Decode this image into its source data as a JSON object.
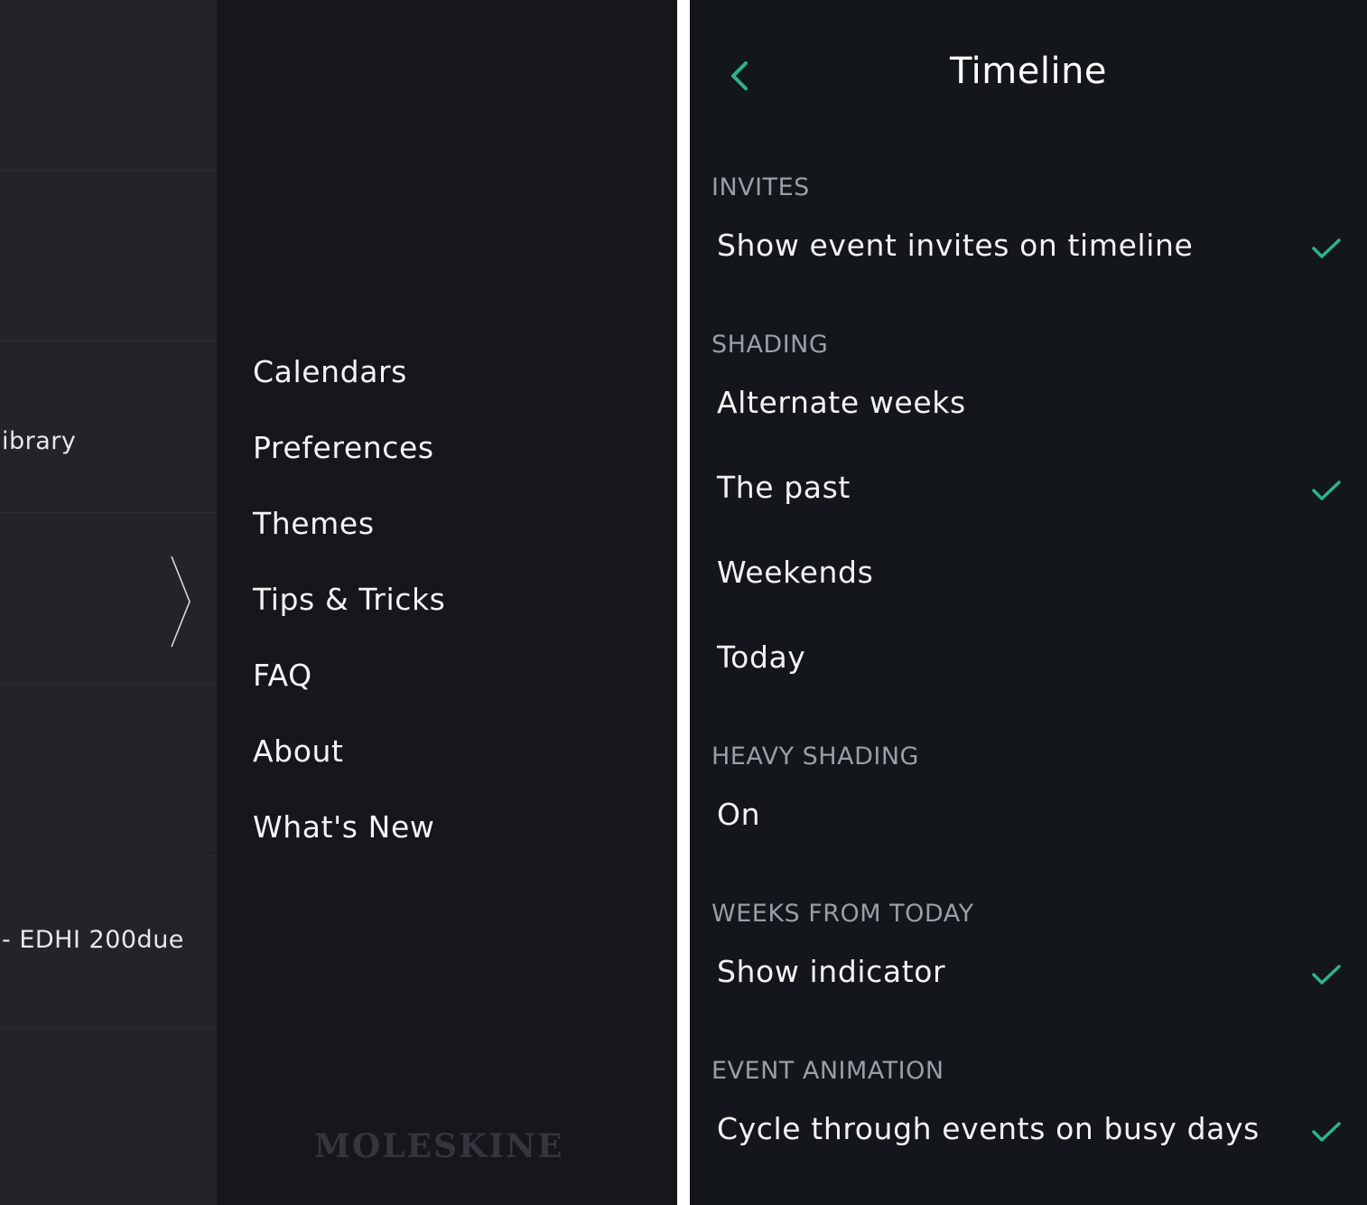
{
  "strip": {
    "row_texts": [
      "ibrary",
      "- EDHI 200due"
    ]
  },
  "menu": {
    "items": [
      "Calendars",
      "Preferences",
      "Themes",
      "Tips & Tricks",
      "FAQ",
      "About",
      "What's New"
    ],
    "logo": "MOLESKINE"
  },
  "panel": {
    "title": "Timeline",
    "sections": [
      {
        "header": "INVITES",
        "rows": [
          {
            "label": "Show event invites on timeline",
            "checked": true
          }
        ]
      },
      {
        "header": "SHADING",
        "rows": [
          {
            "label": "Alternate weeks",
            "checked": false
          },
          {
            "label": "The past",
            "checked": true
          },
          {
            "label": "Weekends",
            "checked": false
          },
          {
            "label": "Today",
            "checked": false
          }
        ]
      },
      {
        "header": "HEAVY SHADING",
        "rows": [
          {
            "label": "On",
            "checked": false
          }
        ]
      },
      {
        "header": "WEEKS FROM TODAY",
        "rows": [
          {
            "label": "Show indicator",
            "checked": true
          }
        ]
      },
      {
        "header": "EVENT ANIMATION",
        "rows": [
          {
            "label": "Cycle through events on busy days",
            "checked": true
          }
        ]
      }
    ]
  },
  "colors": {
    "accent": "#2bb38f",
    "panel_bg": "#13161a",
    "menu_bg": "#15171b",
    "strip_bg": "#232428"
  },
  "icons": {
    "back": "chevron-left-icon",
    "check": "checkmark-icon",
    "strip_chevron": "chevron-right-icon"
  }
}
